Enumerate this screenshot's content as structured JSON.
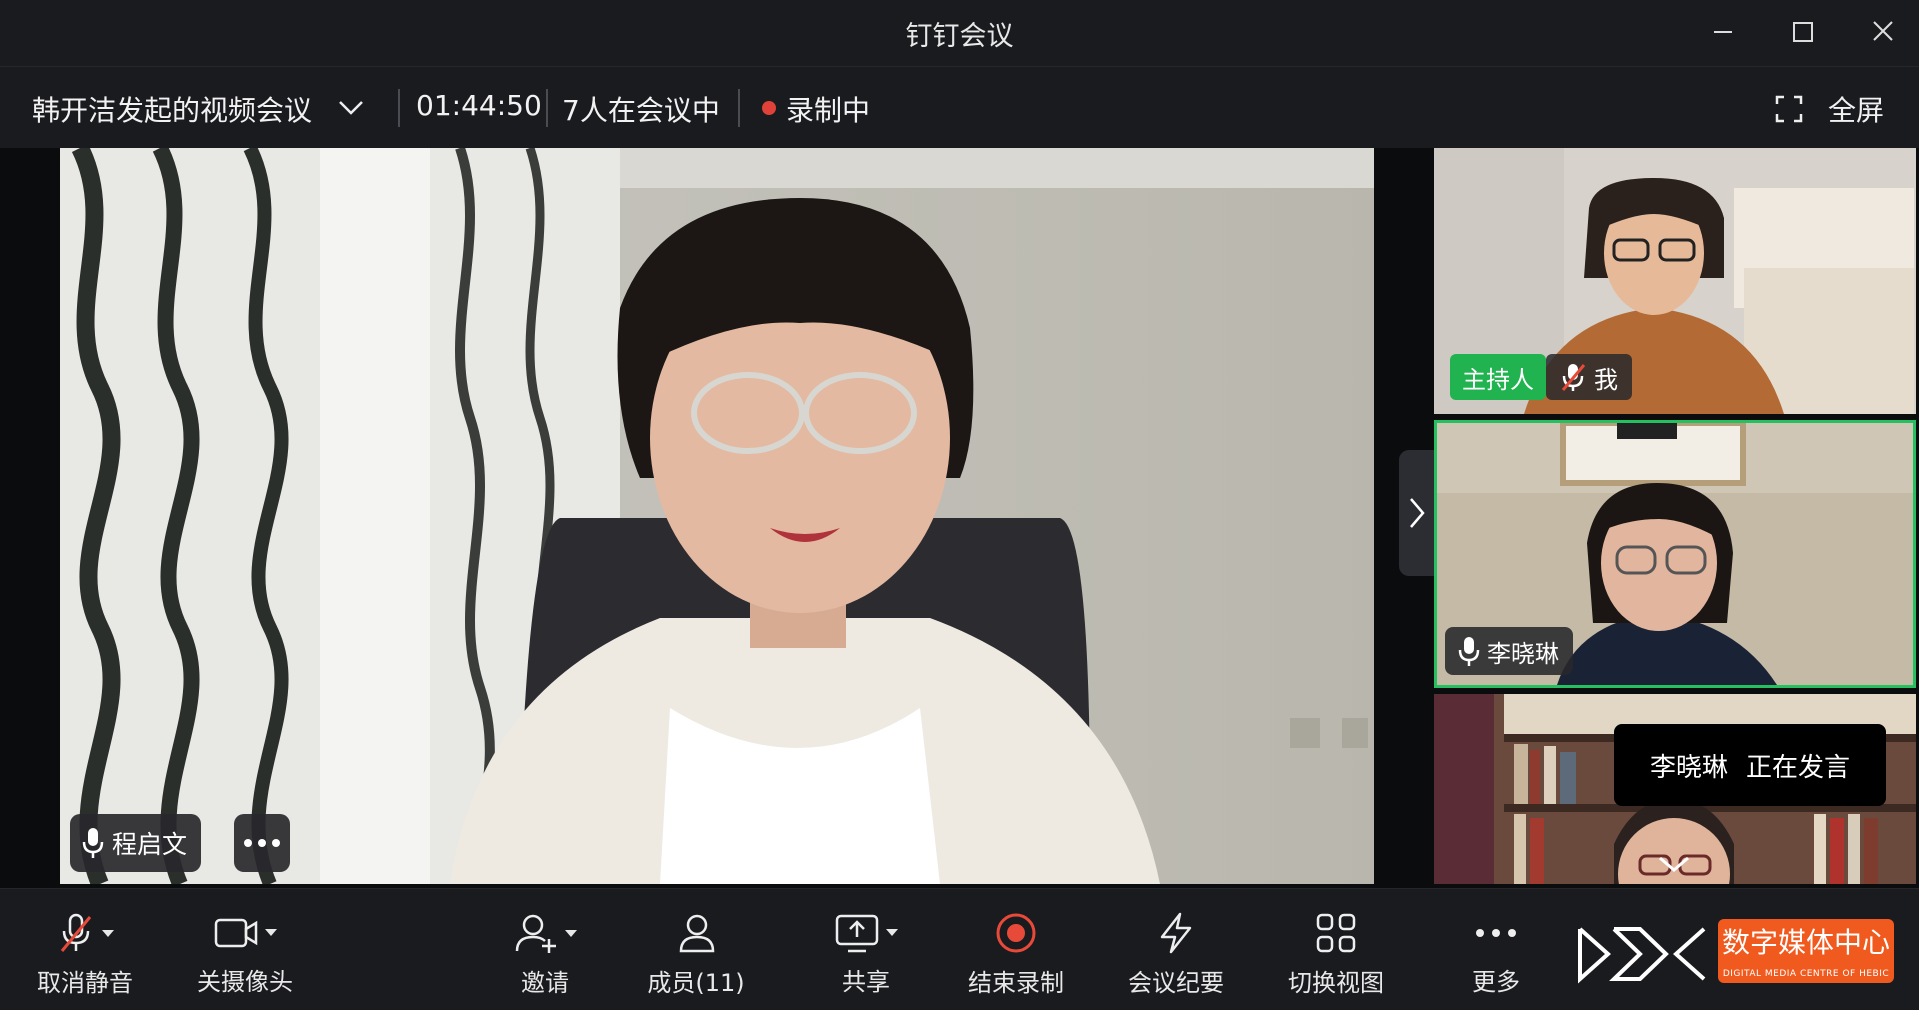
{
  "window": {
    "title": "钉钉会议"
  },
  "info_bar": {
    "meeting_name": "韩开洁发起的视频会议",
    "duration": "01:44:50",
    "participants_in_meeting": "7人在会议中",
    "recording_status": "录制中",
    "fullscreen_label": "全屏"
  },
  "main_video": {
    "speaker_name": "程启文"
  },
  "side_tiles": [
    {
      "role_badge": "主持人",
      "name": "我",
      "mic": "muted"
    },
    {
      "name": "李晓琳",
      "mic": "on",
      "active_speaker": true
    },
    {
      "name": ""
    }
  ],
  "toast": {
    "name": "李晓琳",
    "status": "正在发言"
  },
  "toolbar": {
    "unmute": "取消静音",
    "camera_off": "关摄像头",
    "invite": "邀请",
    "members": "成员(11)",
    "share": "共享",
    "stop_recording": "结束录制",
    "minutes": "会议纪要",
    "switch_view": "切换视图",
    "more": "更多"
  },
  "watermark": {
    "text": "数字媒体中心",
    "sub": "DIGITAL MEDIA CENTRE OF HEBIC"
  },
  "colors": {
    "accent_green": "#20b34f",
    "record_red": "#e0423a",
    "logo_orange": "#f05a1e",
    "titlebar_bg": "#1a1b1f"
  }
}
